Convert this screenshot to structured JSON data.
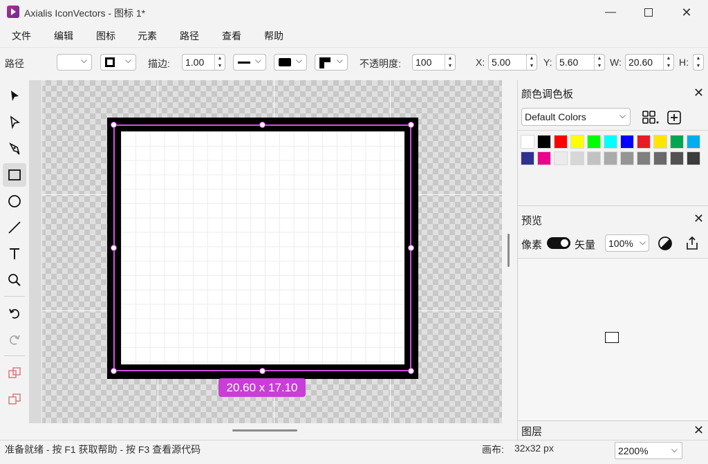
{
  "window": {
    "title": "Axialis IconVectors - 图标 1*",
    "minimize_icon": "minimize-icon",
    "maximize_icon": "maximize-icon",
    "close_icon": "close-icon"
  },
  "menu": [
    "文件",
    "编辑",
    "图标",
    "元素",
    "路径",
    "查看",
    "帮助"
  ],
  "toolbar": {
    "context_label": "路径",
    "stroke_label": "描边:",
    "stroke_width": "1.00",
    "opacity_label": "不透明度:",
    "opacity_value": "100",
    "x_label": "X:",
    "x_value": "5.00",
    "y_label": "Y:",
    "y_value": "5.60",
    "w_label": "W:",
    "w_value": "20.60",
    "h_label": "H:"
  },
  "canvas": {
    "size_label": "20.60 x 17.10",
    "selection_color": "#d34fe0"
  },
  "palette_panel": {
    "title": "颜色调色板",
    "preset": "Default Colors",
    "colors_row1": [
      "#ffffff",
      "#000000",
      "#ff0000",
      "#ffff00",
      "#00ff00",
      "#00ffff",
      "#0000ff",
      "#e81c24",
      "#ffe500",
      "#00a650",
      "#00aeef"
    ],
    "colors_row2": [
      "#2e3192",
      "#ec008c",
      "#ebebeb",
      "#d7d7d7",
      "#c2c2c2",
      "#ababab",
      "#959595",
      "#7f7f7f",
      "#696969",
      "#525252",
      "#3c3c3c"
    ]
  },
  "preview_panel": {
    "title": "预览",
    "pixel_label": "像素",
    "vector_label": "矢量",
    "zoom": "100%"
  },
  "layers_panel": {
    "title": "图层"
  },
  "status": {
    "message": "准备就绪 - 按 F1 获取帮助 - 按 F3 查看源代码",
    "canvas_label": "画布:",
    "canvas_size": "32x32 px",
    "zoom": "2200%"
  }
}
